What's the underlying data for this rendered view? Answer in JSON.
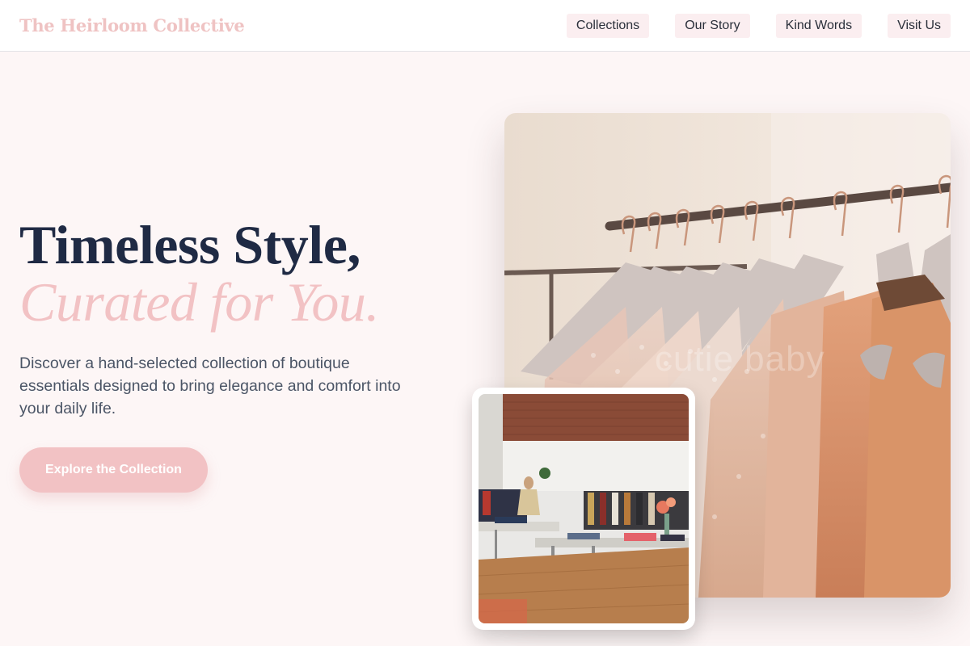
{
  "brand": {
    "name": "The Heirloom Collective"
  },
  "nav": {
    "items": [
      {
        "label": "Collections"
      },
      {
        "label": "Our Story"
      },
      {
        "label": "Kind Words"
      },
      {
        "label": "Visit Us"
      }
    ]
  },
  "hero": {
    "headline_line1": "Timeless Style,",
    "headline_line2": "Curated for You.",
    "description": "Discover a hand-selected collection of boutique essentials designed to bring elegance and comfort into your daily life.",
    "cta_label": "Explore the Collection"
  },
  "images": {
    "main_photo": {
      "subject": "dresses-on-clothing-rack",
      "watermark": "cutie baby"
    },
    "inset_photo": {
      "subject": "boutique-store-interior"
    }
  },
  "colors": {
    "accent_pink": "#f2c2c4",
    "navy_text": "#1f2a44",
    "page_background": "#fdf6f6",
    "nav_pill_background": "#fbeef0"
  }
}
